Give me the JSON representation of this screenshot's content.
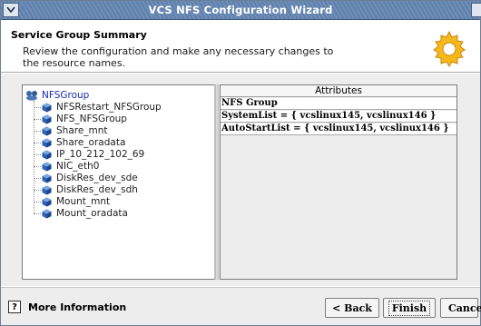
{
  "window": {
    "title": "VCS NFS Configuration Wizard"
  },
  "header": {
    "title": "Service Group Summary",
    "description": "Review the configuration and make any necessary changes to the resource names."
  },
  "tree": {
    "root": "NFSGroup",
    "items": [
      "NFSRestart_NFSGroup",
      "NFS_NFSGroup",
      "Share_mnt",
      "Share_oradata",
      "IP_10_212_102_69",
      "NIC_eth0",
      "DiskRes_dev_sde",
      "DiskRes_dev_sdh",
      "Mount_mnt",
      "Mount_oradata"
    ]
  },
  "attributes": {
    "header": "Attributes",
    "rows": [
      "NFS Group",
      "SystemList = { vcslinux145, vcslinux146 }",
      "AutoStartList = { vcslinux145, vcslinux146 }"
    ]
  },
  "footer": {
    "more_info": "More Information",
    "help_glyph": "?",
    "back": "< Back",
    "finish": "Finish",
    "cancel": "Cancel"
  },
  "icons": {
    "menu": "chevron-down-icon",
    "root": "service-group-icon",
    "resource": "resource-icon",
    "gear": "gear-icon",
    "help": "help-icon"
  },
  "colors": {
    "titlebar": "#6f8fb8",
    "tree_root_label": "#1c2bb0",
    "gear_fill": "#f6b81a"
  }
}
